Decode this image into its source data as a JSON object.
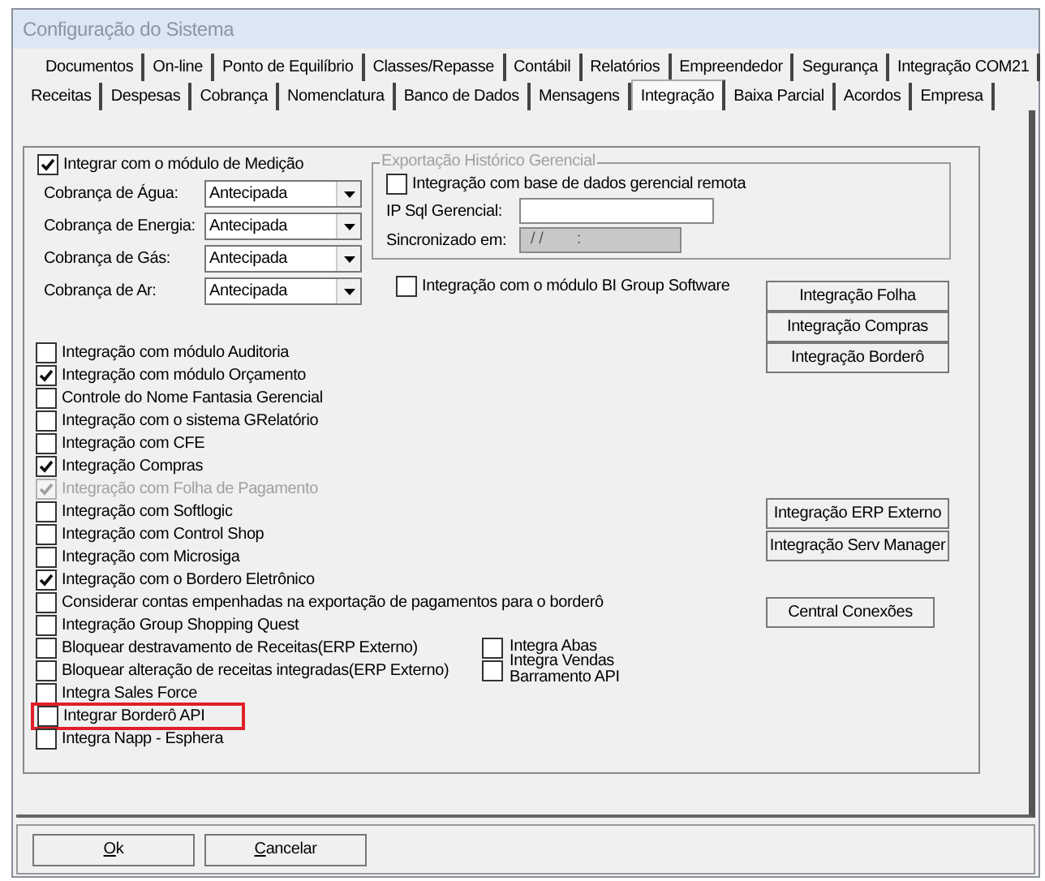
{
  "window": {
    "title": "Configuração do Sistema"
  },
  "tab_rows": [
    {
      "tabs": [
        {
          "label": "Documentos",
          "selected": false
        },
        {
          "label": "On-line",
          "selected": false
        },
        {
          "label": "Ponto de Equilíbrio",
          "selected": false
        },
        {
          "label": "Classes/Repasse",
          "selected": false
        },
        {
          "label": "Contábil",
          "selected": false
        },
        {
          "label": "Relatórios",
          "selected": false
        },
        {
          "label": "Empreendedor",
          "selected": false
        },
        {
          "label": "Segurança",
          "selected": false
        },
        {
          "label": "Integração COM21",
          "selected": false
        }
      ]
    },
    {
      "tabs": [
        {
          "label": "Receitas",
          "selected": false
        },
        {
          "label": "Despesas",
          "selected": false
        },
        {
          "label": "Cobrança",
          "selected": false
        },
        {
          "label": "Nomenclatura",
          "selected": false
        },
        {
          "label": "Banco de Dados",
          "selected": false
        },
        {
          "label": "Mensagens",
          "selected": false
        },
        {
          "label": "Integração",
          "selected": true
        },
        {
          "label": "Baixa Parcial",
          "selected": false
        },
        {
          "label": "Acordos",
          "selected": false
        },
        {
          "label": "Empresa",
          "selected": false
        }
      ]
    }
  ],
  "measurement": {
    "label": "Integrar com o módulo de Medição",
    "checked": true
  },
  "billing_fields": [
    {
      "label": "Cobrança de Água:",
      "value": "Antecipada"
    },
    {
      "label": "Cobrança de Energia:",
      "value": "Antecipada"
    },
    {
      "label": "Cobrança de Gás:",
      "value": "Antecipada"
    },
    {
      "label": "Cobrança de Ar:",
      "value": "Antecipada"
    }
  ],
  "history_export": {
    "legend": "Exportação Histórico Gerencial",
    "remote": {
      "label": "Integração com base de dados gerencial remota",
      "checked": false
    },
    "ip_label": "IP Sql Gerencial:",
    "sync_label": "Sincronizado em:",
    "sync_value": "/ /        :"
  },
  "bi_option": {
    "label": "Integração com o módulo BI Group Software",
    "checked": false
  },
  "integration_buttons": [
    "Integração Folha",
    "Integração Compras",
    "Integração Borderô"
  ],
  "options": [
    {
      "label": "Integração com módulo Auditoria",
      "checked": false,
      "disabled": false,
      "highlighted": false
    },
    {
      "label": "Integração com módulo Orçamento",
      "checked": true,
      "disabled": false,
      "highlighted": false
    },
    {
      "label": "Controle do Nome Fantasia Gerencial",
      "checked": false,
      "disabled": false,
      "highlighted": false
    },
    {
      "label": "Integração com o sistema GRelatório",
      "checked": false,
      "disabled": false,
      "highlighted": false
    },
    {
      "label": "Integração com CFE",
      "checked": false,
      "disabled": false,
      "highlighted": false
    },
    {
      "label": "Integração Compras",
      "checked": true,
      "disabled": false,
      "highlighted": false
    },
    {
      "label": "Integração com Folha de Pagamento",
      "checked": true,
      "disabled": true,
      "highlighted": false
    },
    {
      "label": "Integração com Softlogic",
      "checked": false,
      "disabled": false,
      "highlighted": false
    },
    {
      "label": "Integração com Control Shop",
      "checked": false,
      "disabled": false,
      "highlighted": false
    },
    {
      "label": "Integração com Microsiga",
      "checked": false,
      "disabled": false,
      "highlighted": false
    },
    {
      "label": "Integração com o Bordero Eletrônico",
      "checked": true,
      "disabled": false,
      "highlighted": false
    },
    {
      "label": "Considerar contas empenhadas na exportação de pagamentos para o borderô",
      "checked": false,
      "disabled": false,
      "highlighted": false
    },
    {
      "label": "Integração Group Shopping Quest",
      "checked": false,
      "disabled": false,
      "highlighted": false
    },
    {
      "label": "Bloquear destravamento de Receitas(ERP Externo)",
      "checked": false,
      "disabled": false,
      "highlighted": false
    },
    {
      "label": "Bloquear alteração de receitas integradas(ERP Externo)",
      "checked": false,
      "disabled": false,
      "highlighted": false
    },
    {
      "label": "Integra Sales Force",
      "checked": false,
      "disabled": false,
      "highlighted": false
    },
    {
      "label": "Integrar Borderô API",
      "checked": false,
      "disabled": false,
      "highlighted": true
    },
    {
      "label": "Integra Napp - Esphera",
      "checked": false,
      "disabled": false,
      "highlighted": false
    }
  ],
  "side_options": [
    {
      "label": "Integra Abas",
      "checked": false
    },
    {
      "label": "Integra Vendas Barramento API",
      "checked": false
    }
  ],
  "external_buttons": [
    "Integração ERP Externo",
    "Integração Serv Manager"
  ],
  "connections_button": "Central Conexões",
  "dialog_buttons": [
    "Ok",
    "Cancelar"
  ]
}
